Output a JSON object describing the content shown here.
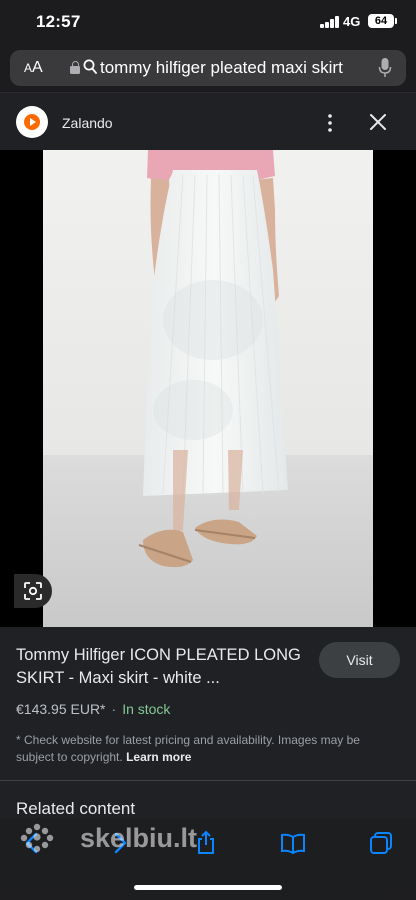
{
  "status_bar": {
    "time": "12:57",
    "network": "4G",
    "battery": "64"
  },
  "url_bar": {
    "aa_label_small": "A",
    "aa_label_large": "A",
    "query": "tommy hilfiger pleated maxi skirt"
  },
  "source": {
    "name": "Zalando"
  },
  "product": {
    "title": "Tommy Hilfiger ICON PLEATED LONG SKIRT - Maxi skirt - white ...",
    "visit_label": "Visit",
    "price": "€143.95 EUR*",
    "separator": "·",
    "stock": "In stock",
    "disclaimer": "* Check website for latest pricing and availability. Images may be subject to copyright.",
    "learn_more": "Learn more"
  },
  "related": {
    "heading": "Related content"
  },
  "watermark": {
    "text": "skelbiu.lt"
  },
  "colors": {
    "stock_green": "#81c995",
    "brand_orange": "#ff6900",
    "link_blue": "#0a84ff"
  },
  "icons": [
    "lock-icon",
    "search-icon",
    "mic-icon",
    "zalando-logo",
    "kebab-icon",
    "close-icon",
    "lens-icon",
    "back-icon",
    "forward-icon",
    "share-icon",
    "bookmarks-icon",
    "tabs-icon"
  ]
}
